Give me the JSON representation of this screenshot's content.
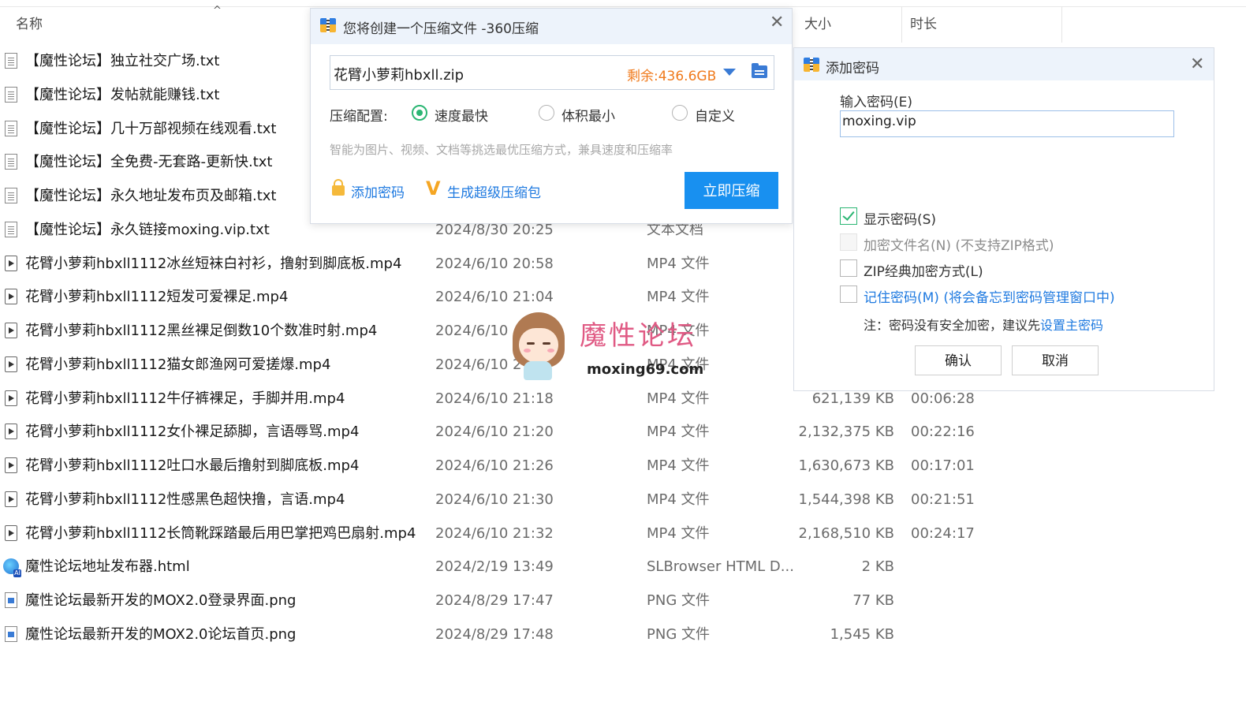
{
  "explorer": {
    "columns": {
      "name": "名称",
      "size": "大小",
      "duration": "时长"
    },
    "files": [
      {
        "icon": "text-file-icon",
        "name": "【魔性论坛】独立社交广场.txt",
        "date": "",
        "type": "",
        "size": "",
        "duration": ""
      },
      {
        "icon": "text-file-icon",
        "name": "【魔性论坛】发帖就能赚钱.txt",
        "date": "",
        "type": "",
        "size": "",
        "duration": ""
      },
      {
        "icon": "text-file-icon",
        "name": "【魔性论坛】几十万部视频在线观看.txt",
        "date": "",
        "type": "",
        "size": "",
        "duration": ""
      },
      {
        "icon": "text-file-icon",
        "name": "【魔性论坛】全免费-无套路-更新快.txt",
        "date": "",
        "type": "",
        "size": "",
        "duration": ""
      },
      {
        "icon": "text-file-icon",
        "name": "【魔性论坛】永久地址发布页及邮箱.txt",
        "date": "",
        "type": "",
        "size": "",
        "duration": ""
      },
      {
        "icon": "text-file-icon",
        "name": "【魔性论坛】永久链接moxing.vip.txt",
        "date": "2024/8/30 20:25",
        "type": "文本文档",
        "size": "",
        "duration": ""
      },
      {
        "icon": "video-file-icon",
        "name": "花臂小萝莉hbxll1112冰丝短袜白衬衫，撸射到脚底板.mp4",
        "date": "2024/6/10 20:58",
        "type": "MP4 文件",
        "size": "",
        "duration": ""
      },
      {
        "icon": "video-file-icon",
        "name": "花臂小萝莉hbxll1112短发可爱裸足.mp4",
        "date": "2024/6/10 21:04",
        "type": "MP4 文件",
        "size": "",
        "duration": ""
      },
      {
        "icon": "video-file-icon",
        "name": "花臂小萝莉hbxll1112黑丝裸足倒数10个数准时射.mp4",
        "date": "2024/6/10",
        "type": "MP4 文件",
        "size": "",
        "duration": ""
      },
      {
        "icon": "video-file-icon",
        "name": "花臂小萝莉hbxll1112猫女郎渔网可爱搓爆.mp4",
        "date": "2024/6/10 2",
        "type": "MP4 文件",
        "size": "",
        "duration": ""
      },
      {
        "icon": "video-file-icon",
        "name": "花臂小萝莉hbxll1112牛仔裤裸足，手脚并用.mp4",
        "date": "2024/6/10 21:18",
        "type": "MP4 文件",
        "size": "621,139 KB",
        "duration": "00:06:28"
      },
      {
        "icon": "video-file-icon",
        "name": "花臂小萝莉hbxll1112女仆裸足舔脚，言语辱骂.mp4",
        "date": "2024/6/10 21:20",
        "type": "MP4 文件",
        "size": "2,132,375 KB",
        "duration": "00:22:16"
      },
      {
        "icon": "video-file-icon",
        "name": "花臂小萝莉hbxll1112吐口水最后撸射到脚底板.mp4",
        "date": "2024/6/10 21:26",
        "type": "MP4 文件",
        "size": "1,630,673 KB",
        "duration": "00:17:01"
      },
      {
        "icon": "video-file-icon",
        "name": "花臂小萝莉hbxll1112性感黑色超快撸，言语.mp4",
        "date": "2024/6/10 21:30",
        "type": "MP4 文件",
        "size": "1,544,398 KB",
        "duration": "00:21:51"
      },
      {
        "icon": "video-file-icon",
        "name": "花臂小萝莉hbxll1112长筒靴踩踏最后用巴掌把鸡巴扇射.mp4",
        "date": "2024/6/10 21:32",
        "type": "MP4 文件",
        "size": "2,168,510 KB",
        "duration": "00:24:17"
      },
      {
        "icon": "browser-html-icon",
        "name": "魔性论坛地址发布器.html",
        "date": "2024/2/19 13:49",
        "type": "SLBrowser HTML D...",
        "size": "2 KB",
        "duration": ""
      },
      {
        "icon": "image-file-icon",
        "name": "魔性论坛最新开发的MOX2.0登录界面.png",
        "date": "2024/8/29 17:47",
        "type": "PNG 文件",
        "size": "77 KB",
        "duration": ""
      },
      {
        "icon": "image-file-icon",
        "name": "魔性论坛最新开发的MOX2.0论坛首页.png",
        "date": "2024/8/29 17:48",
        "type": "PNG 文件",
        "size": "1,545 KB",
        "duration": ""
      }
    ]
  },
  "zip_dialog": {
    "title": "您将创建一个压缩文件 -360压缩",
    "filename": "花臂小萝莉hbxll.zip",
    "remaining": "剩余:436.6GB",
    "config_label": "压缩配置:",
    "options": [
      "速度最快",
      "体积最小",
      "自定义"
    ],
    "selected_option": "速度最快",
    "hint": "智能为图片、视频、文档等挑选最优压缩方式，兼具速度和压缩率",
    "add_password": "添加密码",
    "super_package": "生成超级压缩包",
    "compress_button": "立即压缩"
  },
  "password_dialog": {
    "title": "添加密码",
    "input_label": "输入密码(E)",
    "password_value": "moxing.vip",
    "show_password": {
      "label": "显示密码(S)",
      "checked": true
    },
    "encrypt_filenames": {
      "label": "加密文件名(N) (不支持ZIP格式)",
      "checked": false,
      "disabled": true
    },
    "zip_classic": {
      "label": "ZIP经典加密方式(L)",
      "checked": false
    },
    "remember_password": {
      "label": "记住密码(M) (将会备忘到密码管理窗口中)",
      "checked": false
    },
    "note_prefix": "注：密码没有安全加密，建议先",
    "note_link": "设置主密码",
    "ok": "确认",
    "cancel": "取消"
  },
  "watermark": {
    "title": "魔性论坛",
    "url": "moxing69.com"
  },
  "colors": {
    "accent_blue": "#1890f0",
    "link_blue": "#1f7ae0",
    "remaining_orange": "#f07a1c",
    "check_green": "#2bb673",
    "watermark_pink": "#e05a84"
  }
}
